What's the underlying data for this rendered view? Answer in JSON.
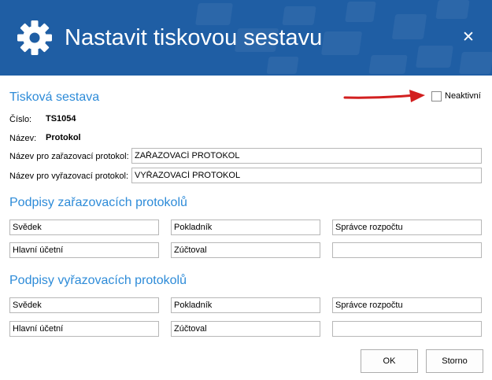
{
  "window": {
    "title": "Nastavit tiskovou sestavu",
    "close_glyph": "✕",
    "header_color": "#1f5ea4"
  },
  "section_main": {
    "title": "Tisková sestava",
    "inactive_label": "Neaktivní",
    "inactive_checked": false,
    "number_label": "Číslo:",
    "number_value": "TS1054",
    "name_label": "Název:",
    "name_value": "Protokol",
    "assign_protocol_label": "Název pro zařazovací protokol:",
    "assign_protocol_value": "ZAŘAZOVACÍ PROTOKOL",
    "remove_protocol_label": "Název pro vyřazovací protokol:",
    "remove_protocol_value": "VYŘAZOVACÍ PROTOKOL"
  },
  "section_assign": {
    "title": "Podpisy zařazovacích protokolů",
    "fields": [
      "Svědek",
      "Pokladník",
      "Správce rozpočtu",
      "Hlavní účetní",
      "Zúčtoval",
      ""
    ]
  },
  "section_remove": {
    "title": "Podpisy vyřazovacích protokolů",
    "fields": [
      "Svědek",
      "Pokladník",
      "Správce rozpočtu",
      "Hlavní účetní",
      "Zúčtoval",
      ""
    ]
  },
  "buttons": {
    "ok_label": "OK",
    "cancel_label": "Storno"
  },
  "colors": {
    "section_title": "#2d8bd8",
    "annotation_arrow": "#d21f1f"
  },
  "icons": {
    "header": "gear-icon",
    "close": "close-icon",
    "annotation": "red-arrow-icon"
  }
}
